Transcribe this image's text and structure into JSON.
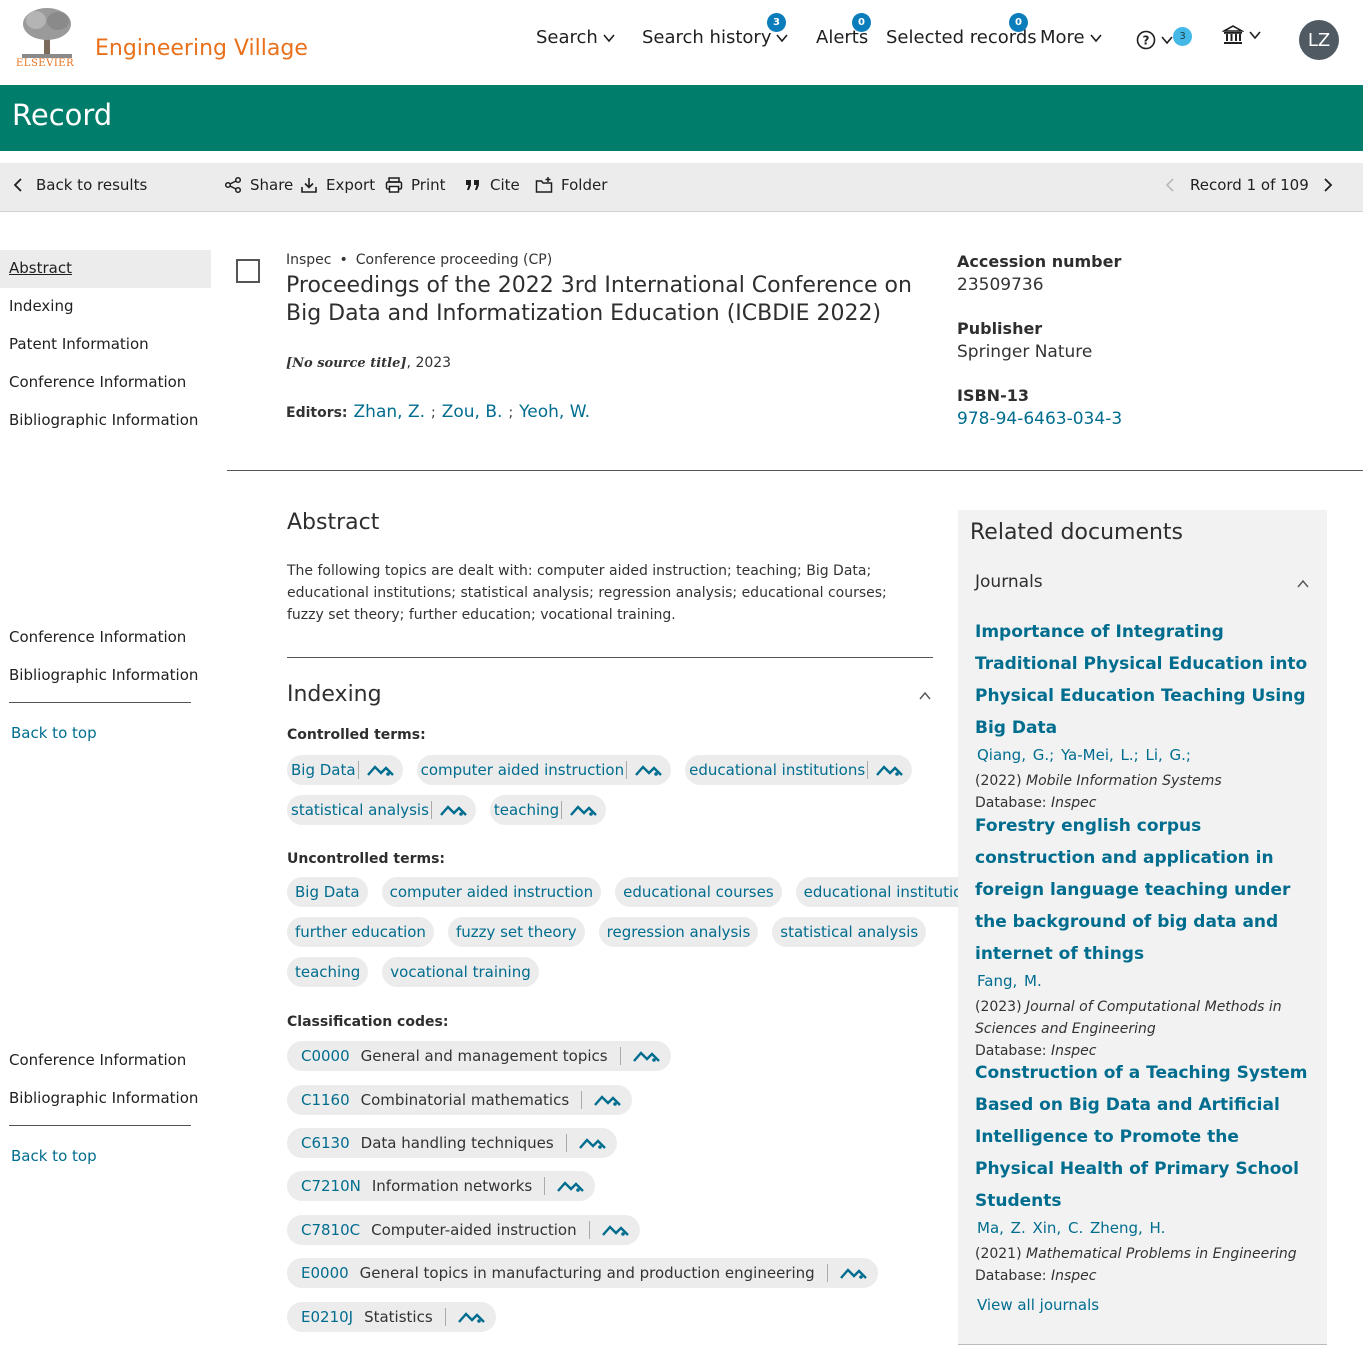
{
  "header": {
    "logo_text": "ELSEVIER",
    "brand": "Engineering Village",
    "nav": {
      "search": "Search",
      "search_history": "Search history",
      "search_history_count": "3",
      "alerts": "Alerts",
      "alerts_count": "0",
      "selected_records": "Selected records",
      "selected_records_count": "0",
      "more": "More",
      "help_count": "3"
    },
    "avatar_initials": "LZ"
  },
  "page_title": "Record",
  "toolbar": {
    "back": "Back to results",
    "share": "Share",
    "export": "Export",
    "print": "Print",
    "cite": "Cite",
    "folder": "Folder",
    "record_position": "Record 1 of 109"
  },
  "leftnav": {
    "items": [
      "Abstract",
      "Indexing",
      "Patent Information",
      "Conference Information",
      "Bibliographic Information"
    ],
    "repeat_a": [
      "Conference Information",
      "Bibliographic Information"
    ],
    "repeat_b": [
      "Conference Information",
      "Bibliographic Information"
    ],
    "back_to_top": "Back to top"
  },
  "record": {
    "database": "Inspec",
    "doc_type": "Conference proceeding (CP)",
    "title": "Proceedings of the 2022 3rd International Conference on Big Data and Informatization Education (ICBDIE 2022)",
    "source_title": "[No source title]",
    "source_year": ", 2023",
    "editors_label": "Editors:",
    "editors": [
      "Zhan, Z.",
      "Zou, B.",
      "Yeoh, W."
    ],
    "accession_label": "Accession number",
    "accession": "23509736",
    "publisher_label": "Publisher",
    "publisher": "Springer Nature",
    "isbn_label": "ISBN-13",
    "isbn": "978-94-6463-034-3"
  },
  "abstract": {
    "heading": "Abstract",
    "text": "The following topics are dealt with: computer aided instruction; teaching; Big Data; educational institutions; statistical analysis; regression analysis; educational courses; fuzzy set theory; further education; vocational training."
  },
  "indexing": {
    "heading": "Indexing",
    "controlled_label": "Controlled terms:",
    "controlled": [
      "Big Data",
      "computer aided instruction",
      "educational institutions",
      "statistical analysis",
      "teaching"
    ],
    "uncontrolled_label": "Uncontrolled terms:",
    "uncontrolled": [
      "Big Data",
      "computer aided instruction",
      "educational courses",
      "educational institutions",
      "further education",
      "fuzzy set theory",
      "regression analysis",
      "statistical analysis",
      "teaching",
      "vocational training"
    ],
    "classification_label": "Classification codes:",
    "classification": [
      {
        "code": "C0000",
        "label": "General and management topics"
      },
      {
        "code": "C1160",
        "label": "Combinatorial mathematics"
      },
      {
        "code": "C6130",
        "label": "Data handling techniques"
      },
      {
        "code": "C7210N",
        "label": "Information networks"
      },
      {
        "code": "C7810C",
        "label": "Computer-aided instruction"
      },
      {
        "code": "E0000",
        "label": "General topics in manufacturing and production engineering"
      },
      {
        "code": "E0210J",
        "label": "Statistics"
      }
    ]
  },
  "related": {
    "heading": "Related documents",
    "journals_label": "Journals",
    "items": [
      {
        "title": "Importance of Integrating Traditional Physical Education into Physical Education Teaching Using Big Data",
        "authors": "Qiang, G.; Ya-Mei, L.;   Li, G.;",
        "year": "(2022)",
        "journal": "Mobile Information Systems",
        "db_label": "Database:",
        "db": "Inspec"
      },
      {
        "title": "Forestry english corpus construction and application in foreign language teaching under the background of big data and internet of things",
        "authors": "Fang, M.",
        "year": "(2023)",
        "journal": "Journal of Computational Methods in Sciences and Engineering",
        "db_label": "Database:",
        "db": "Inspec"
      },
      {
        "title": "Construction of a Teaching System Based on Big Data and Artificial Intelligence to Promote the Physical Health of Primary School Students",
        "authors": "Ma, Z.    Xin, C.   Zheng, H.",
        "year": "(2021)",
        "journal": "Mathematical Problems in Engineering",
        "db_label": "Database:",
        "db": "Inspec"
      }
    ],
    "view_all": "View all journals"
  }
}
